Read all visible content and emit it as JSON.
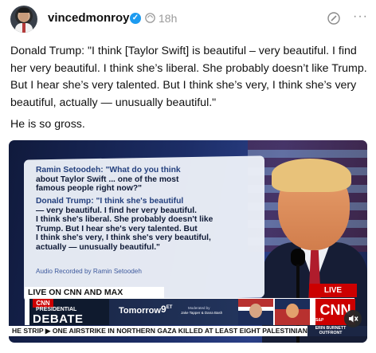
{
  "post": {
    "username": "vincedmonroy",
    "verified_icon": "verified-badge-icon",
    "timestamp": "18h",
    "text": "Donald Trump: \"I think [Taylor Swift] is beautiful – very beautiful. I find her very beautiful. I think she’s liberal. She probably doesn’t like Trump. But I hear she’s very talented. But I think she’s very, I think she’s very beautiful, actually — unusually beautiful.\"",
    "comment": "He is so gross."
  },
  "video": {
    "quote_lines": [
      "Ramin Setoodeh: \"What do you think",
      "about Taylor Swift ... one of the most",
      "famous people right now?\"",
      "Donald Trump: \"I think she's beautiful",
      "— very beautiful. I find her very beautiful.",
      "I think she's liberal. She probably doesn't like",
      "Trump. But I hear she's very talented. But",
      "I think she's very, I think she's very beautiful,",
      "actually — unusually beautiful.\""
    ],
    "audio_credit": "Audio Recorded by Ramin Setoodeh",
    "live_banner": "LIVE ON CNN AND MAX",
    "live_badge": "LIVE",
    "cnn_small": "CNN",
    "presidential": "PRESIDENTIAL",
    "debate": "DEBATE",
    "tomorrow": "Tomorrow",
    "time": "9",
    "time_suffix": "ET",
    "moderated_by": "Moderated by",
    "moderators": "Jake Tapper & Dana Bash",
    "cnn_logo": "CNN",
    "sp_label": "S&P",
    "ticker": "HE STRIP  ▶  ONE AIRSTRIKE IN NORTHERN GAZA KILLED AT LEAST EIGHT PALESTINIANS",
    "ticker_right": "ERIN BURNETT OUTFRONT"
  },
  "icons": {
    "thread": "thread-icon",
    "edit": "edit-icon",
    "more": "more-icon",
    "mute": "mute-icon"
  }
}
